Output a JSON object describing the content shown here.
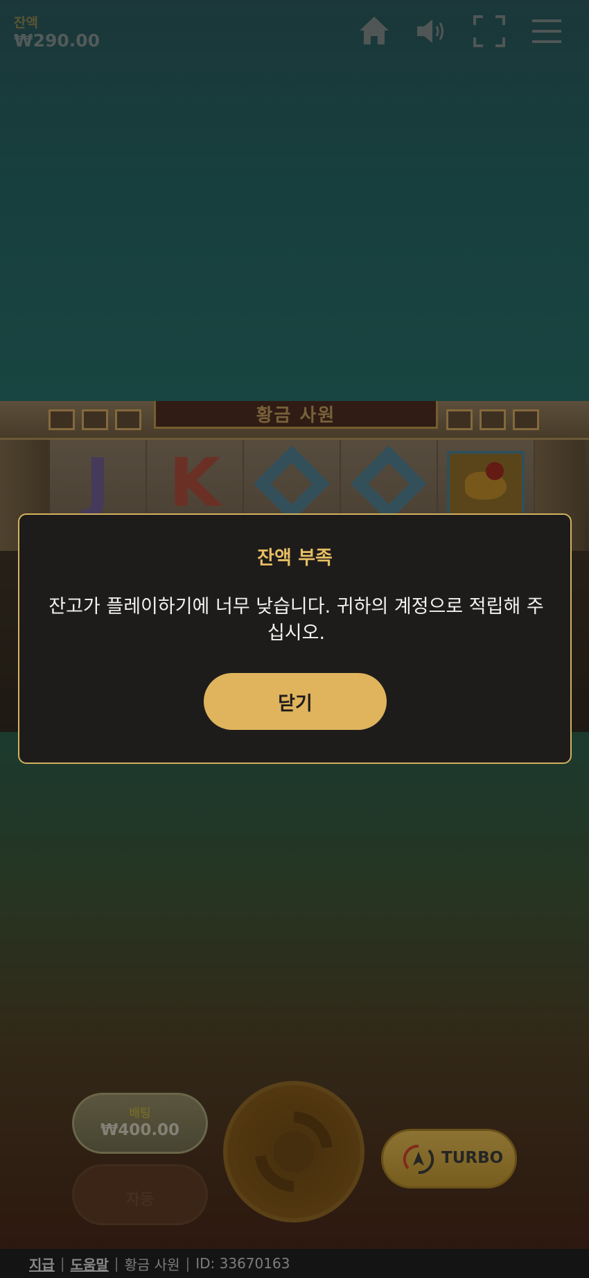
{
  "hud": {
    "balance_label": "잔액",
    "balance_value": "₩290.00",
    "icons": [
      "home-icon",
      "speaker-icon",
      "fullscreen-icon",
      "menu-icon"
    ]
  },
  "game": {
    "title": "황금 사원",
    "reel_symbols": [
      "J",
      "K",
      "Q-diamond",
      "Q-diamond",
      "bird"
    ]
  },
  "modal": {
    "title": "잔액 부족",
    "message": "잔고가 플레이하기에 너무 낮습니다. 귀하의 계정으로 적립해 주십시오.",
    "close_label": "닫기"
  },
  "controls": {
    "bet_label": "배팅",
    "bet_value": "₩400.00",
    "auto_label": "자동",
    "turbo_label": "TURBO"
  },
  "footer": {
    "link_payout": "지급",
    "link_help": "도움말",
    "game_name": "황금 사원",
    "game_id": "ID: 33670163"
  },
  "colors": {
    "accent_gold": "#dfb45d",
    "modal_bg": "#1e1c1b",
    "modal_title": "#e7be63"
  }
}
